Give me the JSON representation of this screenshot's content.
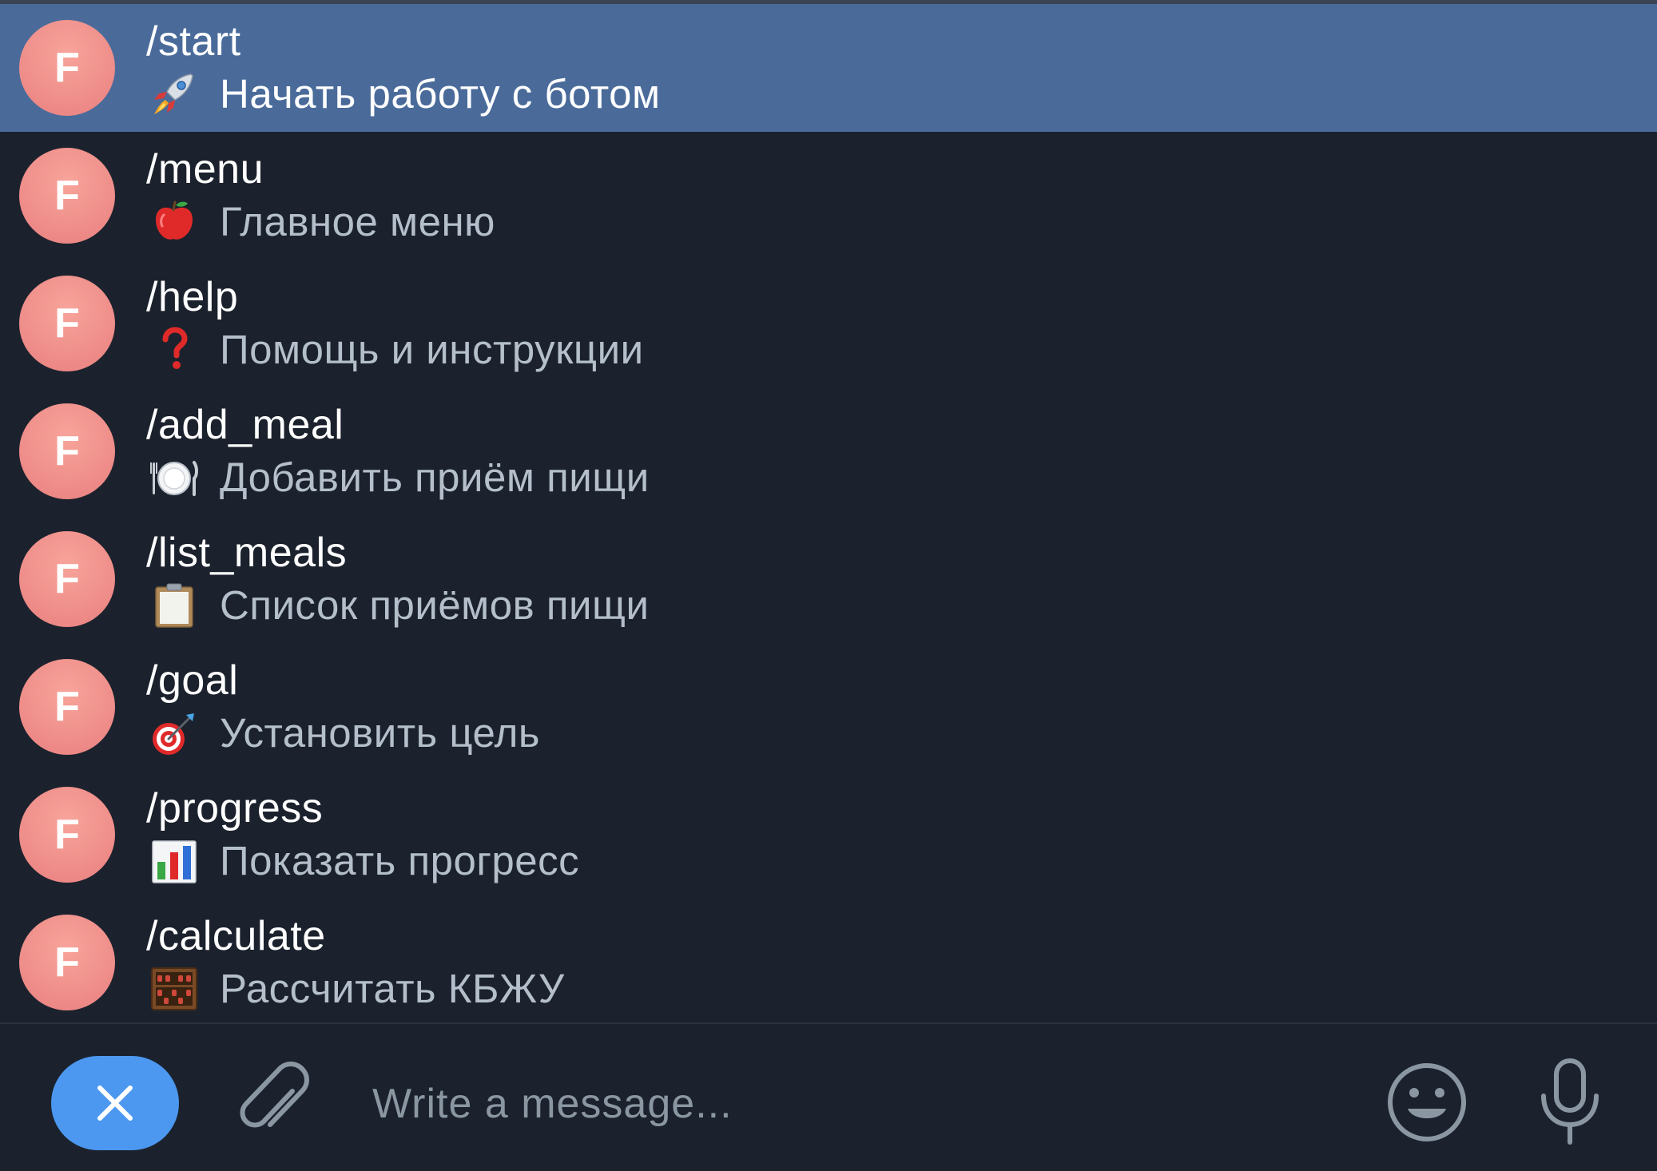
{
  "commands": [
    {
      "name": "/start",
      "emoji": "rocket-icon",
      "description": "Начать работу с ботом",
      "avatar_letter": "F",
      "selected": true
    },
    {
      "name": "/menu",
      "emoji": "apple-icon",
      "description": "Главное меню",
      "avatar_letter": "F",
      "selected": false
    },
    {
      "name": "/help",
      "emoji": "question-mark-icon",
      "description": "Помощь и инструкции",
      "avatar_letter": "F",
      "selected": false
    },
    {
      "name": "/add_meal",
      "emoji": "plate-cutlery-icon",
      "description": "Добавить приём пищи",
      "avatar_letter": "F",
      "selected": false
    },
    {
      "name": "/list_meals",
      "emoji": "clipboard-icon",
      "description": "Список приёмов пищи",
      "avatar_letter": "F",
      "selected": false
    },
    {
      "name": "/goal",
      "emoji": "target-dart-icon",
      "description": "Установить цель",
      "avatar_letter": "F",
      "selected": false
    },
    {
      "name": "/progress",
      "emoji": "bar-chart-icon",
      "description": "Показать прогресс",
      "avatar_letter": "F",
      "selected": false
    },
    {
      "name": "/calculate",
      "emoji": "abacus-icon",
      "description": "Рассчитать КБЖУ",
      "avatar_letter": "F",
      "selected": false
    }
  ],
  "composer": {
    "placeholder": "Write a message...",
    "value": ""
  },
  "colors": {
    "background": "#1b222d",
    "selected_row": "#4a6b9a",
    "avatar": "#ef8e8a",
    "close_button": "#4c98f0"
  }
}
